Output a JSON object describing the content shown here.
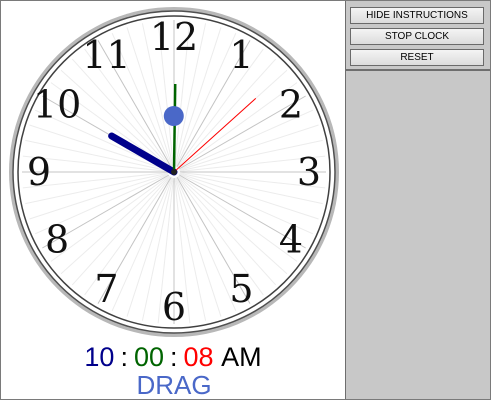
{
  "controls": {
    "hide_instructions_label": "HIDE INSTRUCTIONS",
    "stop_clock_label": "STOP CLOCK",
    "reset_label": "RESET"
  },
  "clock": {
    "numerals": [
      "12",
      "1",
      "2",
      "3",
      "4",
      "5",
      "6",
      "7",
      "8",
      "9",
      "10",
      "11"
    ],
    "time": {
      "hours": 10,
      "minutes": 0,
      "seconds": 8
    },
    "hand_colors": {
      "hour": "#00008b",
      "minute": "#006400",
      "second": "#ff0000",
      "drag_knob": "#4a68c8"
    }
  },
  "readout": {
    "hours": "10",
    "separator": ":",
    "minutes": "00",
    "seconds": "08",
    "ampm": "AM",
    "colors": {
      "hours": "#00008b",
      "minutes": "#006400",
      "seconds": "#ff0000",
      "ampm": "#000000"
    }
  },
  "drag_label": "DRAG",
  "drag_label_color": "#4a68c8"
}
